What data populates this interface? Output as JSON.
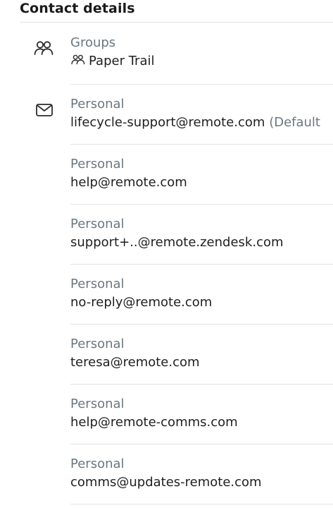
{
  "section": {
    "title": "Contact details"
  },
  "groups": {
    "label": "Groups",
    "value": "Paper Trail",
    "icon": "group-icon"
  },
  "emails": [
    {
      "label": "Personal",
      "value": "lifecycle-support@remote.com",
      "suffix": " (Default"
    },
    {
      "label": "Personal",
      "value": "help@remote.com"
    },
    {
      "label": "Personal",
      "value": "support+..@remote.zendesk.com"
    },
    {
      "label": "Personal",
      "value": "no-reply@remote.com"
    },
    {
      "label": "Personal",
      "value": "teresa@remote.com"
    },
    {
      "label": "Personal",
      "value": "help@remote-comms.com"
    },
    {
      "label": "Personal",
      "value": "comms@updates-remote.com"
    }
  ],
  "colors": {
    "label": "#6b7780",
    "text": "#1f1f1f",
    "divider": "#e3e3e3"
  }
}
